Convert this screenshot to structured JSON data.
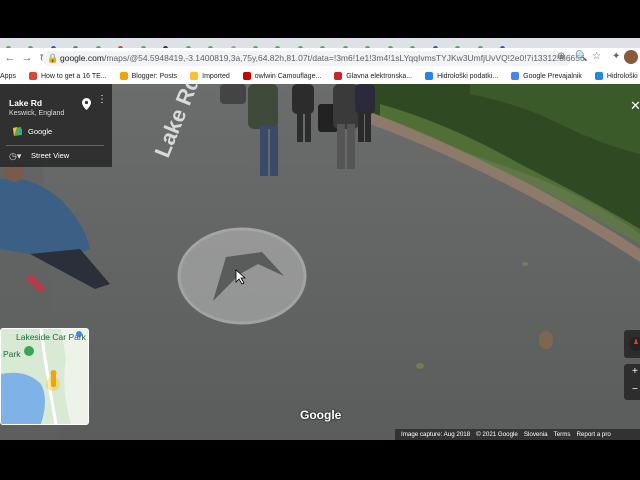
{
  "browser": {
    "url_host": "google.com",
    "url_path": "/maps/@54.5948419,-3.1400819,3a,75y,64.82h,81.07t/data=!3m6!1e1!3m4!1sLYqqIvmsTYJKw3UmfjUvVQ!2e0!7i13312!8i6656",
    "bookmarks": [
      {
        "label": "Apps",
        "color": "#4285f4"
      },
      {
        "label": "How to get a 16 TE...",
        "color": "#db4437"
      },
      {
        "label": "Blogger: Posts",
        "color": "#f4a400"
      },
      {
        "label": "Imported",
        "color": "#fbc02d"
      },
      {
        "label": "owlwin Camouflage...",
        "color": "#cc0000"
      },
      {
        "label": "Glavna elektronska...",
        "color": "#c62828"
      },
      {
        "label": "Hidrološki podatki...",
        "color": "#1e88e5"
      },
      {
        "label": "Google Prevajalnik",
        "color": "#4285f4"
      },
      {
        "label": "Hidrološki podatki...",
        "color": "#1e88e5"
      }
    ]
  },
  "infocard": {
    "title": "Lake Rd",
    "subtitle": "Keswick, England",
    "google_label": "Google",
    "streetview_label": "Street View"
  },
  "scene": {
    "road_text": "Lake Rd"
  },
  "minimap": {
    "label_top": "Lakeside Car Park",
    "label_side": "Park"
  },
  "watermark": "Google",
  "footer": {
    "capture": "Image capture: Aug 2018",
    "copyright": "© 2021 Google",
    "country": "Slovenia",
    "terms": "Terms",
    "report": "Report a pro"
  }
}
